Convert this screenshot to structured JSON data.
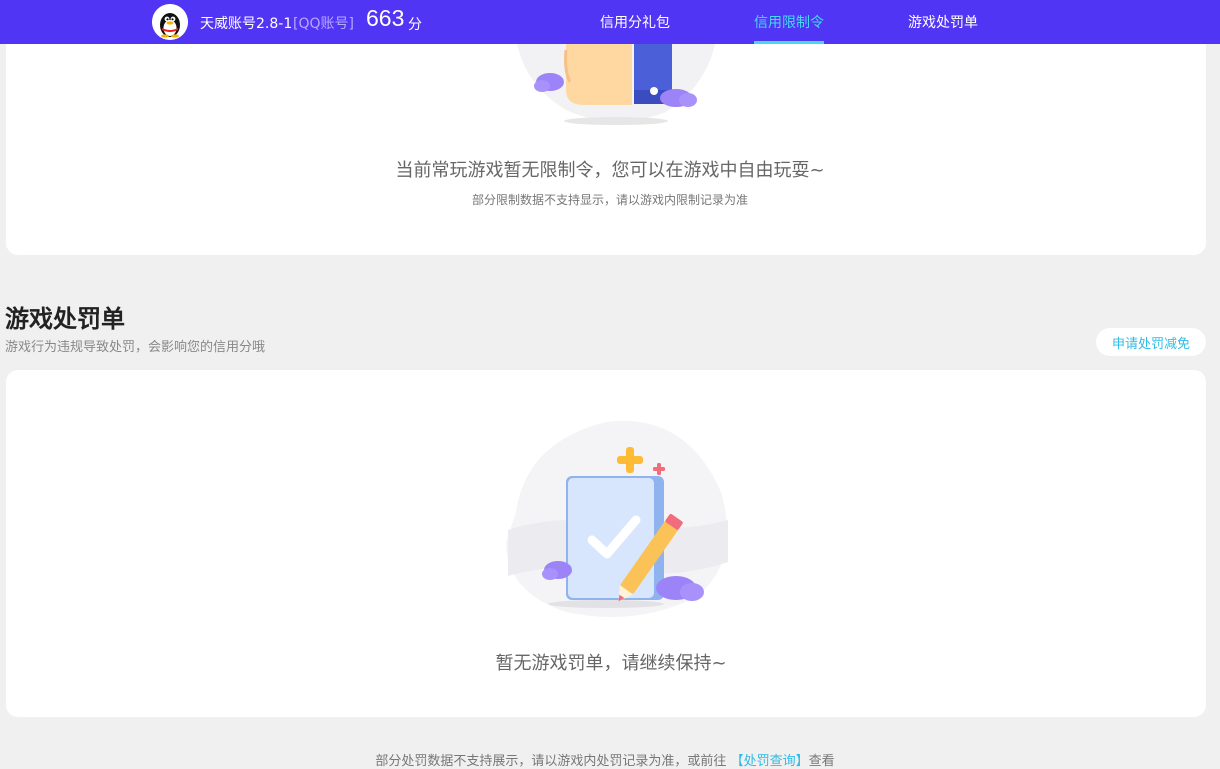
{
  "header": {
    "account_name": "天威账号2.8-1",
    "account_type": "[QQ账号]",
    "score_value": "663",
    "score_unit": "分",
    "nav": [
      {
        "label": "信用分礼包",
        "active": false
      },
      {
        "label": "信用限制令",
        "active": true
      },
      {
        "label": "游戏处罚单",
        "active": false
      }
    ]
  },
  "restriction_card": {
    "message": "当前常玩游戏暂无限制令，您可以在游戏中自由玩耍~",
    "sub_message": "部分限制数据不支持显示，请以游戏内限制记录为准"
  },
  "penalty_section": {
    "title": "游戏处罚单",
    "description": "游戏行为违规导致处罚，会影响您的信用分哦",
    "appeal_button": "申请处罚减免",
    "empty_message": "暂无游戏罚单，请继续保持~"
  },
  "footer": {
    "note_prefix": "部分处罚数据不支持展示，请以游戏内处罚记录为准，或前往",
    "link_label": "【处罚查询】",
    "note_suffix": "查看"
  },
  "colors": {
    "header_bg": "#5036f4",
    "active_nav": "#45d9f2",
    "link": "#2fbce6"
  }
}
